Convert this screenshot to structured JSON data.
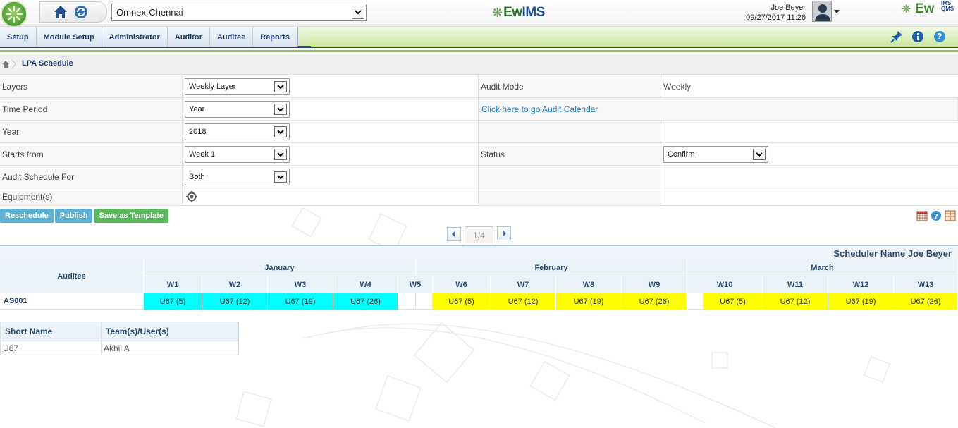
{
  "header": {
    "site": "Omnex-Chennai",
    "center_logo_prefix": "Ew",
    "center_logo_suffix": "IMS",
    "user_name": "Joe Beyer",
    "datetime": "09/27/2017 11:26",
    "right_logo_main": "Ew",
    "right_logo_ims": "IMS",
    "right_logo_qms": "QMS"
  },
  "menu": {
    "items": [
      "Setup",
      "Module Setup",
      "Administrator",
      "Auditor",
      "Auditee",
      "Reports"
    ]
  },
  "breadcrumb": {
    "title": "LPA Schedule"
  },
  "form": {
    "layers_label": "Layers",
    "layers_value": "Weekly Layer",
    "audit_mode_label": "Audit Mode",
    "audit_mode_value": "Weekly",
    "time_period_label": "Time Period",
    "time_period_value": "Year",
    "calendar_link": "Click here to go Audit Calendar",
    "year_label": "Year",
    "year_value": "2018",
    "starts_from_label": "Starts from",
    "starts_from_value": "Week 1",
    "status_label": "Status",
    "status_value": "Confirm",
    "schedule_for_label": "Audit Schedule For",
    "schedule_for_value": "Both",
    "equipment_label": "Equipment(s)"
  },
  "buttons": {
    "reschedule": "Reschedule",
    "publish": "Publish",
    "save_template": "Save as Template"
  },
  "pager": {
    "page": "1/4"
  },
  "schedule": {
    "scheduler_label": "Scheduler Name  Joe Beyer",
    "auditee_header": "Auditee",
    "months": [
      "January",
      "February",
      "March"
    ],
    "weeks": [
      "W1",
      "W2",
      "W3",
      "W4",
      "W5",
      "W6",
      "W7",
      "W8",
      "W9",
      "W10",
      "W11",
      "W12",
      "W13"
    ],
    "row_label": "AS001",
    "cells": [
      "U67 (5)",
      "U67 (12)",
      "U67 (19)",
      "U67 (26)",
      "",
      "U67 (5)",
      "U67 (12)",
      "U67 (19)",
      "U67 (26)",
      "U67 (5)",
      "U67 (12)",
      "U67 (19)",
      "U67 (26)"
    ],
    "colors": {
      "january": "#00ffff",
      "february": "#ffff00",
      "march": "#ffff00"
    }
  },
  "legend": {
    "col1": "Short Name",
    "col2": "Team(s)/User(s)",
    "rows": [
      {
        "short": "U67",
        "team": "Akhil A"
      }
    ]
  }
}
